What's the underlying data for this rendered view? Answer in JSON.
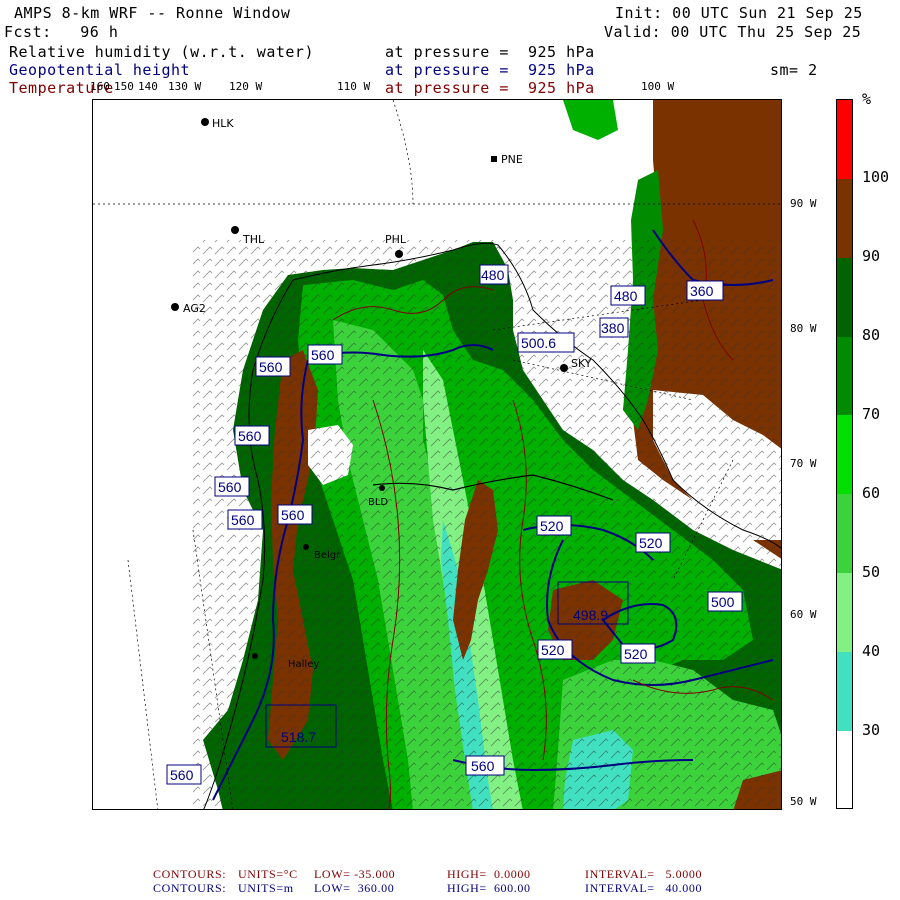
{
  "header": {
    "title": "AMPS 8-km WRF -- Ronne Window",
    "forecast": "Fcst:   96 h",
    "init": "Init: 00 UTC Sun 21 Sep 25",
    "valid": "Valid: 00 UTC Thu 25 Sep 25",
    "smoothing": "sm= 2",
    "fields": [
      {
        "name": "Relative humidity (w.r.t. water)",
        "level": "at pressure =  925 hPa",
        "color": "#000000"
      },
      {
        "name": "Geopotential height",
        "level": "at pressure =  925 hPa",
        "color": "#000080"
      },
      {
        "name": "Temperature",
        "level": "at pressure =  925 hPa",
        "color": "#800000"
      }
    ]
  },
  "longitude_labels": [
    "160",
    "150",
    "140",
    "130 W",
    "120 W",
    "110 W",
    "100 W"
  ],
  "latitude_labels": [
    "90 W",
    "80 W",
    "70 W",
    "60 W",
    "50 W"
  ],
  "stations": [
    "HLK",
    "PNE",
    "THL",
    "PHL",
    "AG2",
    "SKY",
    "BLD",
    "Belgr",
    "Halley"
  ],
  "height_contour_labels": [
    "560",
    "560",
    "560",
    "560",
    "560",
    "560",
    "520",
    "520",
    "520",
    "520",
    "500.6",
    "498.9",
    "480",
    "480",
    "380",
    "360",
    "500",
    "518.7",
    "560",
    "560"
  ],
  "colorbar": {
    "unit": "%",
    "labels": [
      "100",
      "90",
      "80",
      "70",
      "60",
      "50",
      "40",
      "30"
    ],
    "colors": [
      "#ff0000",
      "#7a3300",
      "#006400",
      "#008b00",
      "#00e000",
      "#3cd23c",
      "#82f082",
      "#40e0c0",
      "#ffffff"
    ]
  },
  "footer": {
    "temperature": {
      "label": "CONTOURS:",
      "units": "UNITS=°C",
      "low": "LOW= -35.000",
      "high": "HIGH=  0.0000",
      "interval": "INTERVAL=   5.0000",
      "color": "#800000"
    },
    "height": {
      "label": "CONTOURS:",
      "units": "UNITS=m",
      "low": "LOW=  360.00",
      "high": "HIGH=  600.00",
      "interval": "INTERVAL=   40.000",
      "color": "#000080"
    }
  }
}
